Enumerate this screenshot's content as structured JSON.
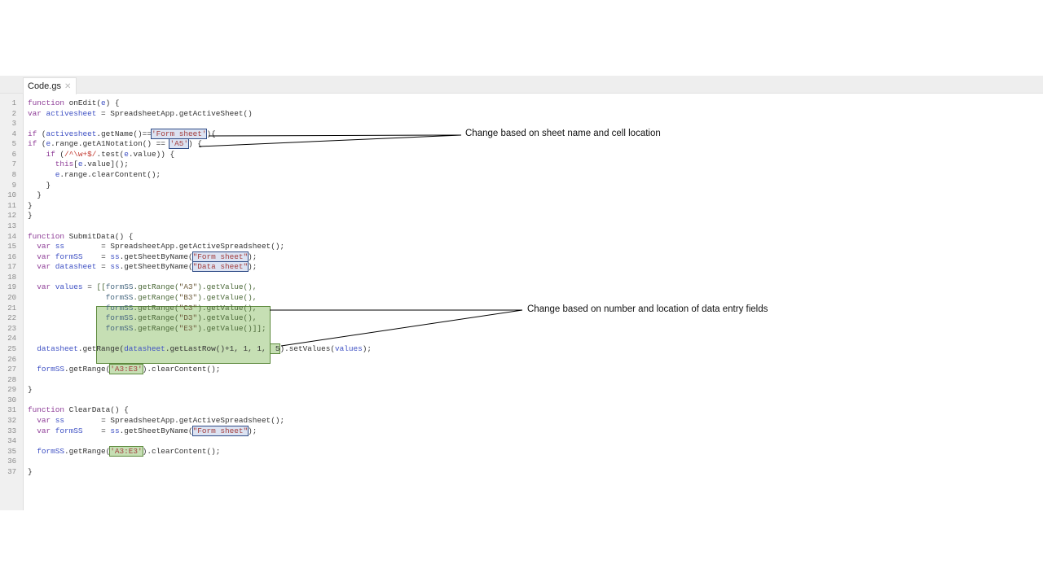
{
  "tab": {
    "label": "Code.gs",
    "close_icon": "close-icon"
  },
  "colors": {
    "keyword": "#8e3c97",
    "variable": "#3f51c4",
    "string": "#a33d3d",
    "box_blue": "#dce3f2",
    "box_green": "#c6dfb4"
  },
  "code_lines": [
    [
      [
        "kw",
        "function"
      ],
      [
        "plain",
        " onEdit("
      ],
      [
        "var",
        "e"
      ],
      [
        "plain",
        ") {"
      ]
    ],
    [
      [
        "kw",
        "var"
      ],
      [
        "plain",
        " "
      ],
      [
        "var",
        "activesheet"
      ],
      [
        "plain",
        " = SpreadsheetApp.getActiveSheet()"
      ]
    ],
    [],
    [
      [
        "kw",
        "if"
      ],
      [
        "plain",
        " ("
      ],
      [
        "var",
        "activesheet"
      ],
      [
        "plain",
        ".getName()=="
      ],
      [
        "str",
        "'Form sheet'",
        "blue"
      ],
      [
        "plain",
        "){"
      ]
    ],
    [
      [
        "kw",
        "if"
      ],
      [
        "plain",
        " ("
      ],
      [
        "var",
        "e"
      ],
      [
        "plain",
        ".range.getA1Notation() == "
      ],
      [
        "str",
        "'A5'",
        "blue"
      ],
      [
        "plain",
        ") {"
      ]
    ],
    [
      [
        "plain",
        "    "
      ],
      [
        "kw",
        "if"
      ],
      [
        "plain",
        " ("
      ],
      [
        "re",
        "/^\\w+$/"
      ],
      [
        "plain",
        ".test("
      ],
      [
        "var",
        "e"
      ],
      [
        "plain",
        ".value)) {"
      ]
    ],
    [
      [
        "plain",
        "      "
      ],
      [
        "kw",
        "this"
      ],
      [
        "plain",
        "["
      ],
      [
        "var",
        "e"
      ],
      [
        "plain",
        ".value]();"
      ]
    ],
    [
      [
        "plain",
        "      "
      ],
      [
        "var",
        "e"
      ],
      [
        "plain",
        ".range.clearContent();"
      ]
    ],
    [
      [
        "plain",
        "    }"
      ]
    ],
    [
      [
        "plain",
        "  }"
      ]
    ],
    [
      [
        "plain",
        "}"
      ]
    ],
    [
      [
        "plain",
        "}"
      ]
    ],
    [],
    [
      [
        "kw",
        "function"
      ],
      [
        "plain",
        " SubmitData() {"
      ]
    ],
    [
      [
        "plain",
        "  "
      ],
      [
        "kw",
        "var"
      ],
      [
        "plain",
        " "
      ],
      [
        "var",
        "ss"
      ],
      [
        "plain",
        "        = SpreadsheetApp.getActiveSpreadsheet();"
      ]
    ],
    [
      [
        "plain",
        "  "
      ],
      [
        "kw",
        "var"
      ],
      [
        "plain",
        " "
      ],
      [
        "var",
        "formSS"
      ],
      [
        "plain",
        "    = "
      ],
      [
        "var",
        "ss"
      ],
      [
        "plain",
        ".getSheetByName("
      ],
      [
        "str",
        "\"Form sheet\"",
        "blue"
      ],
      [
        "plain",
        ");"
      ]
    ],
    [
      [
        "plain",
        "  "
      ],
      [
        "kw",
        "var"
      ],
      [
        "plain",
        " "
      ],
      [
        "var",
        "datasheet"
      ],
      [
        "plain",
        " = "
      ],
      [
        "var",
        "ss"
      ],
      [
        "plain",
        ".getSheetByName("
      ],
      [
        "str",
        "\"Data sheet\"",
        "blue"
      ],
      [
        "plain",
        ");"
      ]
    ],
    [],
    [
      [
        "plain",
        "  "
      ],
      [
        "kw",
        "var"
      ],
      [
        "plain",
        " "
      ],
      [
        "var",
        "values"
      ],
      [
        "plain",
        " = "
      ],
      [
        "green",
        "[["
      ],
      [
        "var",
        "formSS",
        "g"
      ],
      [
        "green",
        ".getRange("
      ],
      [
        "str",
        "\"A3\"",
        "g"
      ],
      [
        "green",
        ").getValue(),"
      ]
    ],
    [
      [
        "plain",
        "                 "
      ],
      [
        "var",
        "formSS",
        "g"
      ],
      [
        "green",
        ".getRange("
      ],
      [
        "str",
        "\"B3\"",
        "g"
      ],
      [
        "green",
        ").getValue(),"
      ]
    ],
    [
      [
        "plain",
        "                 "
      ],
      [
        "var",
        "formSS",
        "g"
      ],
      [
        "green",
        ".getRange("
      ],
      [
        "str",
        "\"C3\"",
        "g"
      ],
      [
        "green",
        ").getValue(),"
      ]
    ],
    [
      [
        "plain",
        "                 "
      ],
      [
        "var",
        "formSS",
        "g"
      ],
      [
        "green",
        ".getRange("
      ],
      [
        "str",
        "\"D3\"",
        "g"
      ],
      [
        "green",
        ").getValue(),"
      ]
    ],
    [
      [
        "plain",
        "                 "
      ],
      [
        "var",
        "formSS",
        "g"
      ],
      [
        "green",
        ".getRange("
      ],
      [
        "str",
        "\"E3\"",
        "g"
      ],
      [
        "green",
        ").getValue()]];"
      ]
    ],
    [],
    [
      [
        "plain",
        "  "
      ],
      [
        "var",
        "datasheet"
      ],
      [
        "plain",
        ".getRange("
      ],
      [
        "var",
        "datasheet"
      ],
      [
        "plain",
        ".getLastRow()+1, 1, 1, "
      ],
      [
        "plain",
        " 5",
        "green"
      ],
      [
        "plain",
        ").setValues("
      ],
      [
        "var",
        "values"
      ],
      [
        "plain",
        ");"
      ]
    ],
    [],
    [
      [
        "plain",
        "  "
      ],
      [
        "var",
        "formSS"
      ],
      [
        "plain",
        ".getRange("
      ],
      [
        "str",
        "'A3:E3'",
        "green"
      ],
      [
        "plain",
        ").clearContent();"
      ]
    ],
    [],
    [
      [
        "plain",
        "}"
      ]
    ],
    [],
    [
      [
        "kw",
        "function"
      ],
      [
        "plain",
        " ClearData() {"
      ]
    ],
    [
      [
        "plain",
        "  "
      ],
      [
        "kw",
        "var"
      ],
      [
        "plain",
        " "
      ],
      [
        "var",
        "ss"
      ],
      [
        "plain",
        "        = SpreadsheetApp.getActiveSpreadsheet();"
      ]
    ],
    [
      [
        "plain",
        "  "
      ],
      [
        "kw",
        "var"
      ],
      [
        "plain",
        " "
      ],
      [
        "var",
        "formSS"
      ],
      [
        "plain",
        "    = "
      ],
      [
        "var",
        "ss"
      ],
      [
        "plain",
        ".getSheetByName("
      ],
      [
        "str",
        "\"Form sheet\"",
        "blue"
      ],
      [
        "plain",
        ");"
      ]
    ],
    [],
    [
      [
        "plain",
        "  "
      ],
      [
        "var",
        "formSS"
      ],
      [
        "plain",
        ".getRange("
      ],
      [
        "str",
        "'A3:E3'",
        "green"
      ],
      [
        "plain",
        ").clearContent();"
      ]
    ],
    [],
    [
      [
        "plain",
        "}"
      ]
    ]
  ],
  "annotations": {
    "sheet_note": "Change based on sheet name and cell location",
    "fields_note": "Change based on number  and location of data entry fields"
  }
}
